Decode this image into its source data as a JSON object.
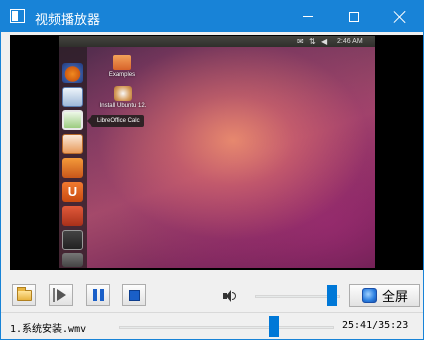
{
  "window": {
    "title": "视频播放器",
    "accent_color": "#1883d7"
  },
  "title_bar": {
    "icon": "app-window-icon",
    "buttons": [
      "minimize-icon",
      "maximize-icon",
      "close-icon"
    ]
  },
  "video": {
    "background": "#000000",
    "frame": {
      "top_panel_time": "2:46 AM",
      "tooltip": "LibreOffice Calc",
      "desktop_icons": [
        {
          "label": "Examples",
          "icon": "folder-icon"
        },
        {
          "label": "Install Ubuntu 12.",
          "icon": "install-icon"
        }
      ],
      "launcher_icons": [
        "firefox-icon",
        "writer-icon",
        "calc-icon",
        "impress-icon",
        "files-icon",
        "ubuntu-one-icon",
        "settings-icon",
        "terminal-icon",
        "trash-icon"
      ]
    }
  },
  "controls": {
    "open_icon": "folder-open-icon",
    "play_icon": "play-icon",
    "pause_icon": "pause-icon",
    "stop_icon": "stop-icon",
    "volume_icon": "speaker-icon",
    "volume_level": 0.91,
    "fullscreen_label": "全屏",
    "fullscreen_icon": "fullscreen-icon"
  },
  "status": {
    "file_name": "1.系统安装.wmv",
    "position_fraction": 0.72,
    "time": "25:41/35:23"
  }
}
